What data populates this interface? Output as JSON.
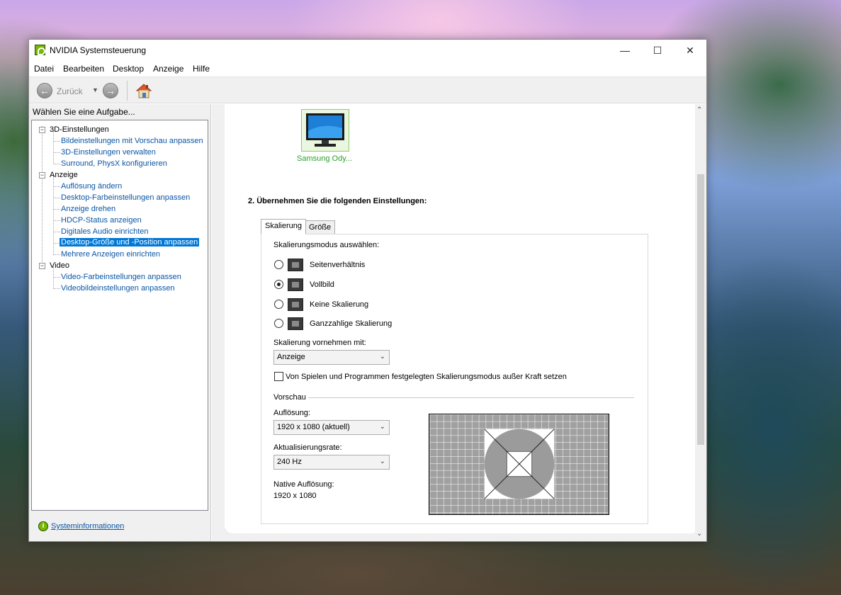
{
  "window": {
    "title": "NVIDIA Systemsteuerung",
    "minimize": "—",
    "maximize": "☐",
    "close": "✕"
  },
  "menu": [
    "Datei",
    "Bearbeiten",
    "Desktop",
    "Anzeige",
    "Hilfe"
  ],
  "toolbar": {
    "back_label": "Zurück"
  },
  "sidebar": {
    "task_label": "Wählen Sie eine Aufgabe...",
    "groups": [
      {
        "label": "3D-Einstellungen",
        "items": [
          "Bildeinstellungen mit Vorschau anpassen",
          "3D-Einstellungen verwalten",
          "Surround, PhysX konfigurieren"
        ]
      },
      {
        "label": "Anzeige",
        "items": [
          "Auflösung ändern",
          "Desktop-Farbeinstellungen anpassen",
          "Anzeige drehen",
          "HDCP-Status anzeigen",
          "Digitales Audio einrichten",
          "Desktop-Größe und -Position anpassen",
          "Mehrere Anzeigen einrichten"
        ]
      },
      {
        "label": "Video",
        "items": [
          "Video-Farbeinstellungen anpassen",
          "Videobildeinstellungen anpassen"
        ]
      }
    ],
    "sysinfo": "Systeminformationen"
  },
  "content": {
    "monitor_label": "Samsung Ody...",
    "section_title": "2. Übernehmen Sie die folgenden Einstellungen:",
    "tabs": [
      "Skalierung",
      "Größe"
    ],
    "mode_label": "Skalierungsmodus auswählen:",
    "modes": [
      "Seitenverhältnis",
      "Vollbild",
      "Keine Skalierung",
      "Ganzzahlige Skalierung"
    ],
    "selected_mode": "Vollbild",
    "perform_label": "Skalierung vornehmen mit:",
    "perform_value": "Anzeige",
    "override_label": "Von Spielen und Programmen festgelegten Skalierungsmodus außer Kraft setzen",
    "override_checked": false,
    "preview_label": "Vorschau",
    "resolution_label": "Auflösung:",
    "resolution_value": "1920 x 1080 (aktuell)",
    "refresh_label": "Aktualisierungsrate:",
    "refresh_value": "240 Hz",
    "native_label": "Native Auflösung:",
    "native_value": "1920 x 1080"
  },
  "colors": {
    "nvidia_green": "#76b900",
    "link_blue": "#0a56a6",
    "selection_blue": "#0078d7"
  }
}
